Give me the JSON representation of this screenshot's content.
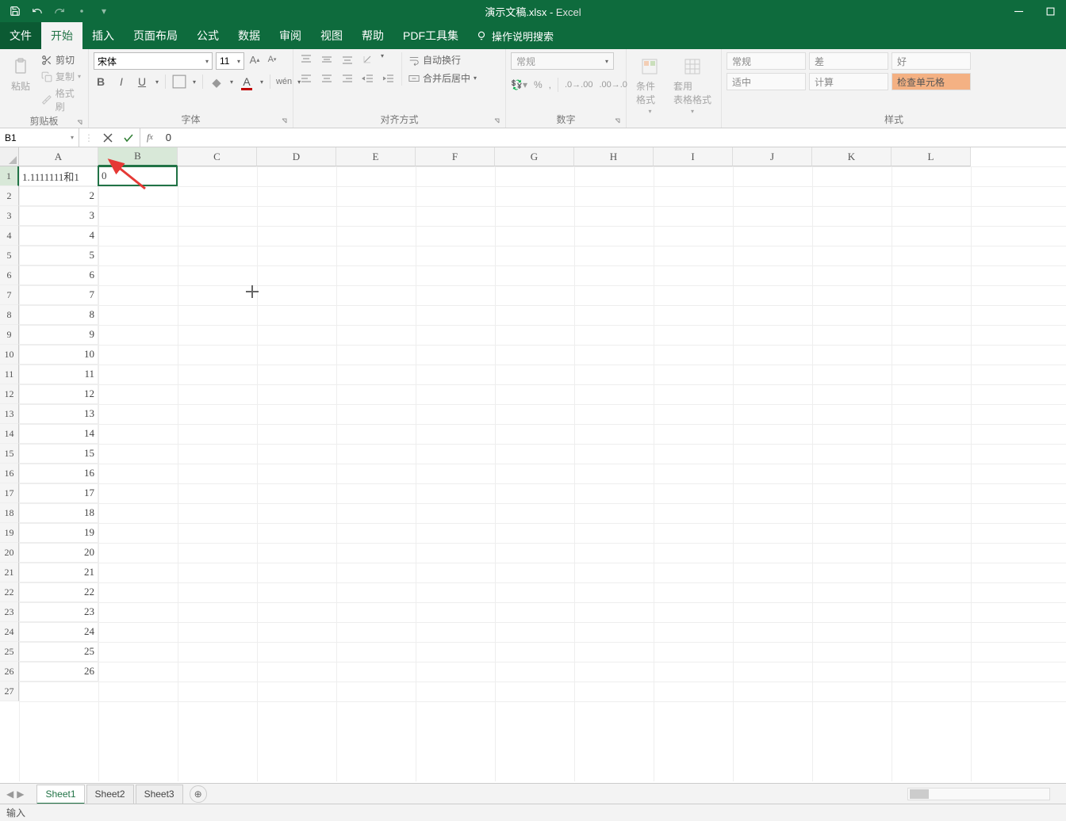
{
  "title": {
    "doc": "演示文稿.xlsx",
    "sep": " - ",
    "app": "Excel"
  },
  "tabs": {
    "file": "文件",
    "home": "开始",
    "insert": "插入",
    "layout": "页面布局",
    "formulas": "公式",
    "data": "数据",
    "review": "审阅",
    "view": "视图",
    "help": "帮助",
    "pdf": "PDF工具集"
  },
  "tellme": "操作说明搜索",
  "ribbon": {
    "clipboard": {
      "paste": "粘贴",
      "cut": "剪切",
      "copy": "复制",
      "format_painter": "格式刷",
      "label": "剪贴板"
    },
    "font": {
      "name": "宋体",
      "size": "11",
      "label": "字体"
    },
    "alignment": {
      "wrap": "自动换行",
      "merge": "合并后居中",
      "label": "对齐方式"
    },
    "number": {
      "format": "常规",
      "label": "数字"
    },
    "styles_btns": {
      "conditional": "条件格式",
      "table": "套用\n表格格式",
      "label": "样式"
    },
    "style_cells": {
      "normal": "常规",
      "bad": "差",
      "good": "好",
      "neutral": "适中",
      "calc": "计算",
      "check": "检查单元格"
    }
  },
  "formula_bar": {
    "name_box": "B1",
    "value": "0"
  },
  "columns": [
    "A",
    "B",
    "C",
    "D",
    "E",
    "F",
    "G",
    "H",
    "I",
    "J",
    "K",
    "L"
  ],
  "col_width_default": 100,
  "rows": 27,
  "selected": {
    "col": 1,
    "row": 0
  },
  "cell_data": {
    "A1": "1.1111111和1",
    "B1": "0",
    "A2": "2",
    "A3": "3",
    "A4": "4",
    "A5": "5",
    "A6": "6",
    "A7": "7",
    "A8": "8",
    "A9": "9",
    "A10": "10",
    "A11": "11",
    "A12": "12",
    "A13": "13",
    "A14": "14",
    "A15": "15",
    "A16": "16",
    "A17": "17",
    "A18": "18",
    "A19": "19",
    "A20": "20",
    "A21": "21",
    "A22": "22",
    "A23": "23",
    "A24": "24",
    "A25": "25",
    "A26": "26"
  },
  "sheets": [
    "Sheet1",
    "Sheet2",
    "Sheet3"
  ],
  "active_sheet": 0,
  "status": "输入"
}
